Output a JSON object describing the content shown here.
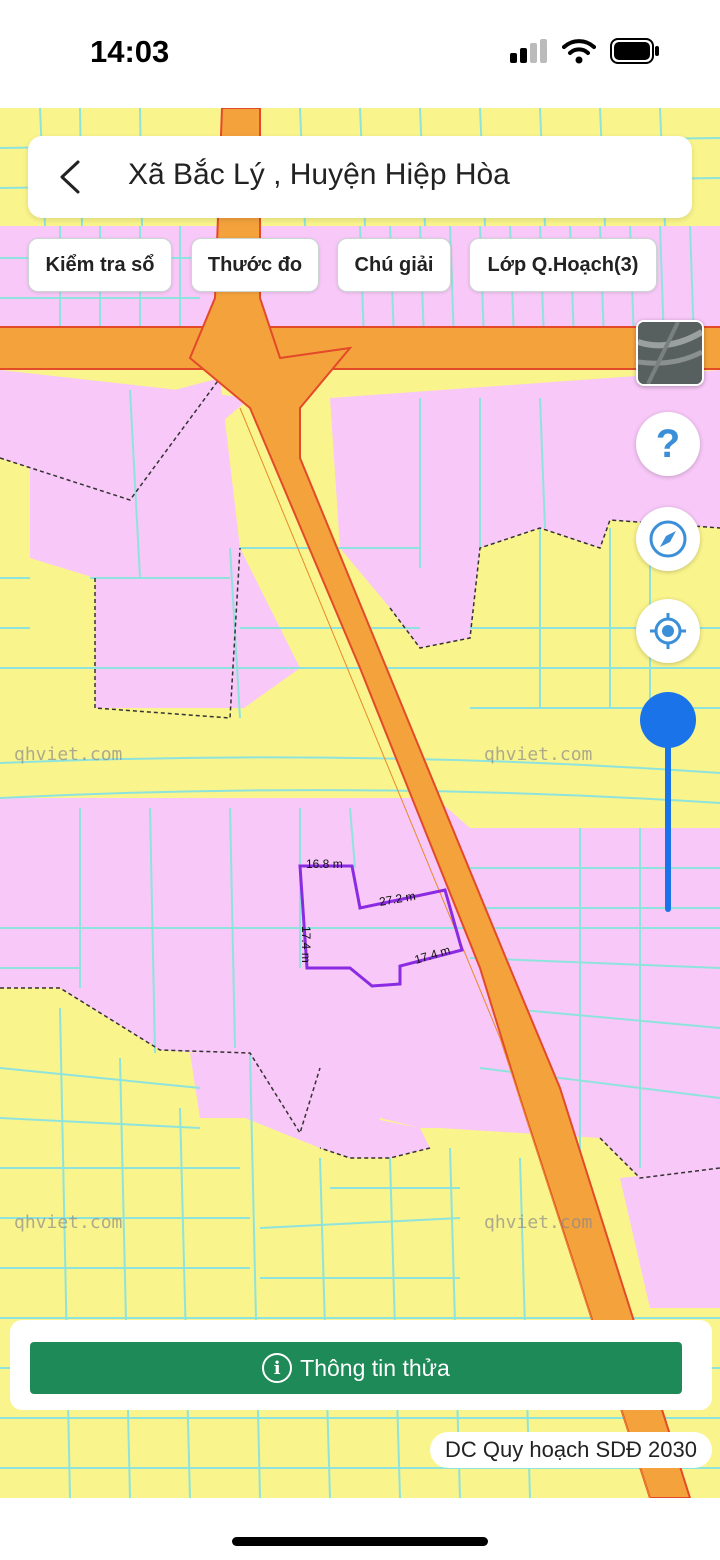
{
  "status_bar": {
    "time": "14:03"
  },
  "search": {
    "title": "Xã Bắc Lý , Huyện Hiệp Hòa"
  },
  "toolbar": {
    "check_book": "Kiểm tra sổ",
    "measure": "Thước đo",
    "legend": "Chú giải",
    "planning_layer": "Lớp Q.Hoạch(3)"
  },
  "map": {
    "watermark": "qhviet.com",
    "parcel_dimensions": [
      "16.8 m",
      "27.2 m",
      "17.4 m",
      "17.4 m"
    ],
    "colors": {
      "residential": "#faf48c",
      "agricultural": "#f8c8f8",
      "road": "#f4a23c",
      "parcel_outline": "#8a2be2",
      "lot_lines": "#8ee4dc"
    }
  },
  "side_controls": {
    "help_glyph": "?",
    "icons": [
      "satellite-layer-icon",
      "help-icon",
      "compass-icon",
      "locate-icon"
    ]
  },
  "bottom": {
    "info_button": "Thông tin thửa",
    "info_glyph": "i",
    "plan_label": "DC Quy hoạch SDĐ 2030"
  }
}
